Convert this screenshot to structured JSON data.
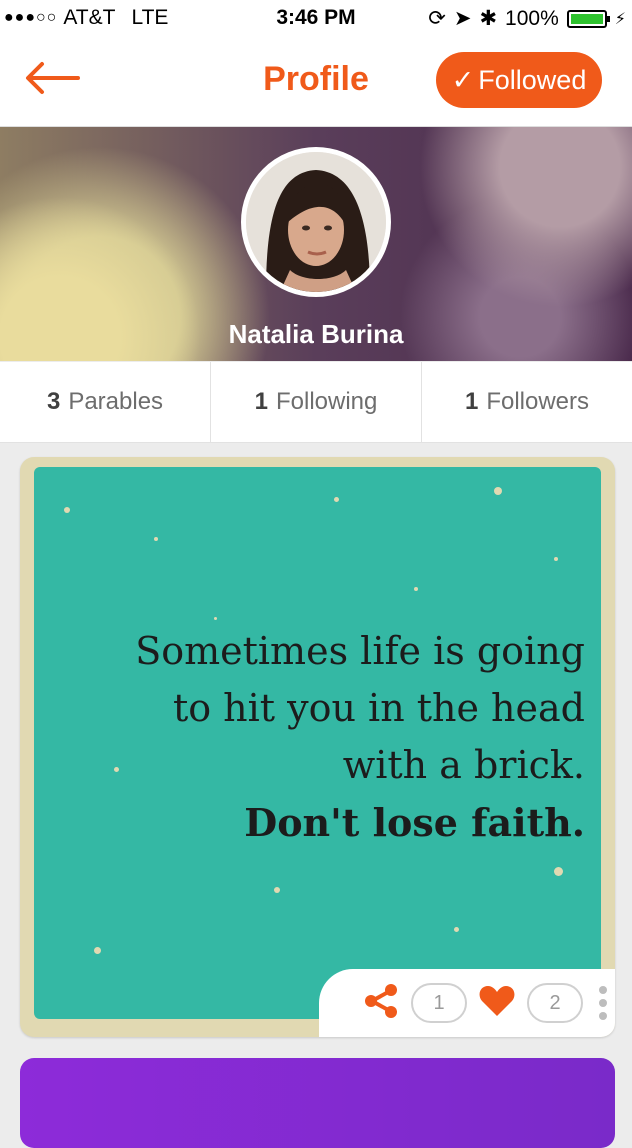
{
  "status_bar": {
    "signal": "●●●○○",
    "carrier": "AT&T",
    "network": "LTE",
    "time": "3:46 PM",
    "battery": "100%",
    "battery_level": 1.0
  },
  "nav": {
    "title": "Profile",
    "followed_label": "Followed",
    "followed_check": "✓",
    "accent_color": "#f05a1a"
  },
  "profile": {
    "name": "Natalia Burina"
  },
  "stats": [
    {
      "count": "3",
      "label": "Parables"
    },
    {
      "count": "1",
      "label": "Following"
    },
    {
      "count": "1",
      "label": "Followers"
    }
  ],
  "card": {
    "quote_lines": [
      "Sometimes life is going",
      "to hit you in the head",
      "with a brick."
    ],
    "quote_bold": "Don't lose faith.",
    "share_count": "1",
    "like_count": "2"
  }
}
